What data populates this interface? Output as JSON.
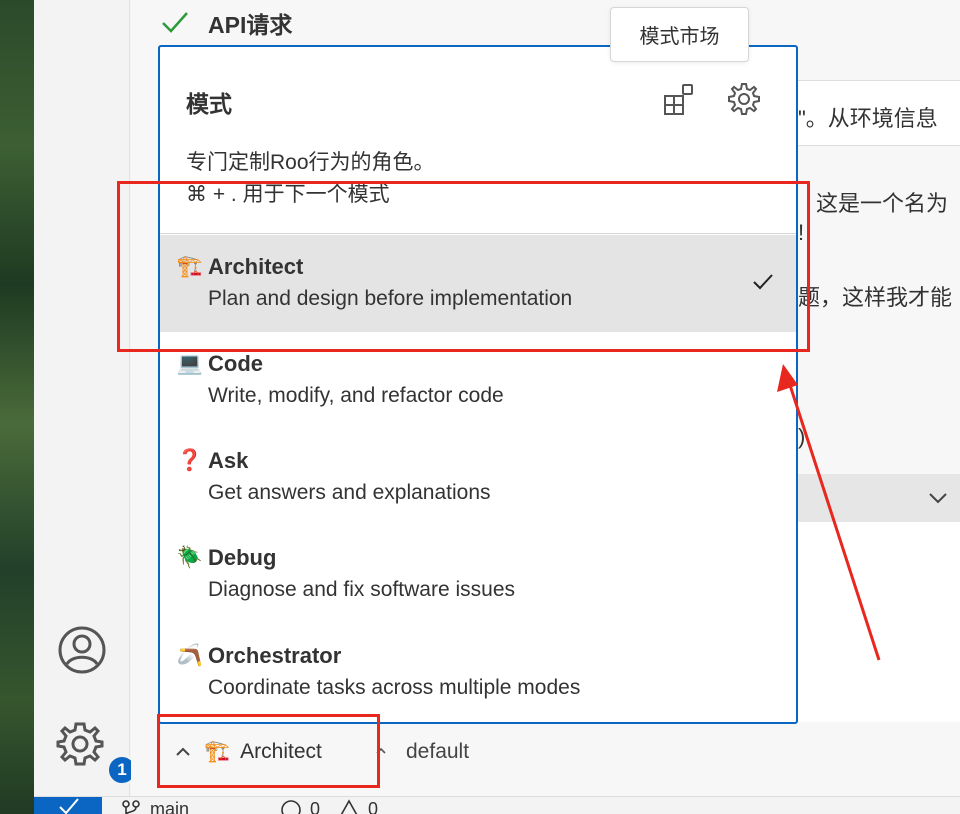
{
  "colors": {
    "accent": "#0a66c2",
    "annotation_red": "#e8271f",
    "selected_row_bg": "#e4e4e4",
    "success_green": "#2e9a3a"
  },
  "main": {
    "api_request_title": "API请求",
    "background_lines": [
      "\"。从环境信息",
      "这是一个名为",
      "!",
      "题，这样我才能",
      ")."
    ]
  },
  "tooltip": {
    "label": "模式市场"
  },
  "mode_menu": {
    "title": "模式",
    "marketplace_icon": "extensions-icon",
    "settings_icon": "gear-icon",
    "description": "专门定制Roo行为的角色。",
    "shortcut_hint": "⌘ + . 用于下一个模式",
    "modes": [
      {
        "emoji": "🏗️",
        "name": "Architect",
        "description": "Plan and design before implementation",
        "selected": true
      },
      {
        "emoji": "💻",
        "name": "Code",
        "description": "Write, modify, and refactor code",
        "selected": false
      },
      {
        "emoji": "❓",
        "name": "Ask",
        "description": "Get answers and explanations",
        "selected": false
      },
      {
        "emoji": "🪲",
        "name": "Debug",
        "description": "Diagnose and fix software issues",
        "selected": false
      },
      {
        "emoji": "🪃",
        "name": "Orchestrator",
        "description": "Coordinate tasks across multiple modes",
        "selected": false
      }
    ]
  },
  "bottom": {
    "mode_selector": {
      "emoji": "🏗️",
      "label": "Architect"
    },
    "profile_selector": {
      "label": "default"
    }
  },
  "activity_bar": {
    "account_icon": "account-icon",
    "settings_icon": "gear-icon",
    "settings_badge": "1"
  },
  "status_bar": {
    "branch": "main",
    "errors": "0",
    "warnings": "0"
  }
}
